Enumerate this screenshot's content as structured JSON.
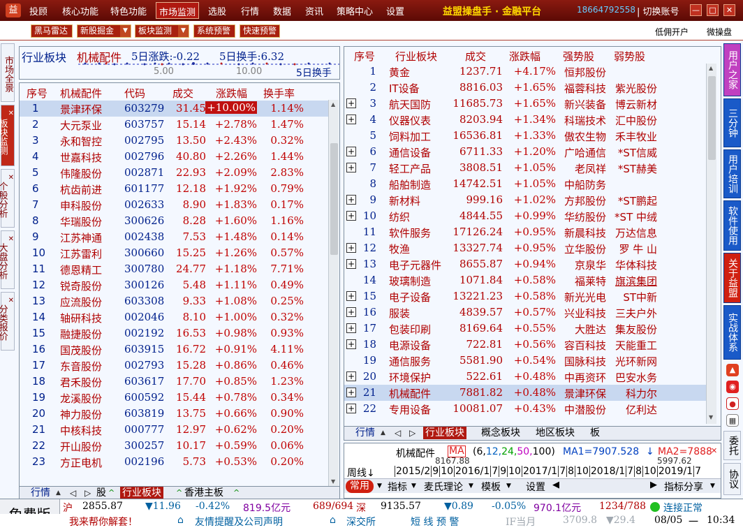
{
  "menu": {
    "items": [
      "投顾",
      "核心功能",
      "特色功能",
      "市场监测",
      "选股",
      "行情",
      "数据",
      "资讯",
      "策略中心",
      "设置"
    ],
    "brand": "益盟操盘手 · 金融平台",
    "phone": "18664792558",
    "switch_account": "| 切换账号"
  },
  "toolbar": {
    "buttons": [
      "黑马雷达",
      "新股掘金",
      "板块监测",
      "系统预警",
      "快速预警"
    ],
    "right1": "低佣开户",
    "right2": "微操盘"
  },
  "left_tabs": [
    "市场全景",
    "板块监测",
    "个股分析",
    "大盘分析",
    "分类报价"
  ],
  "sector_header": {
    "title": "行业板块",
    "name": "机械配件",
    "chg5": "5日涨跌:-0.22",
    "turn5": "5日换手:6.32",
    "tick1": "5.00",
    "tick2": "10.00",
    "tick3": "5日换手"
  },
  "stock_table": {
    "headers": [
      "序号",
      "机械配件",
      "代码",
      "成交",
      "涨跌幅",
      "换手率"
    ],
    "rows": [
      [
        "1",
        "景津环保",
        "603279",
        "31.45",
        "+10.00%",
        "1.14%"
      ],
      [
        "2",
        "大元泵业",
        "603757",
        "15.14",
        "+2.78%",
        "1.47%"
      ],
      [
        "3",
        "永和智控",
        "002795",
        "13.50",
        "+2.43%",
        "0.32%"
      ],
      [
        "4",
        "世嘉科技",
        "002796",
        "40.80",
        "+2.26%",
        "1.44%"
      ],
      [
        "5",
        "伟隆股份",
        "002871",
        "22.93",
        "+2.09%",
        "2.83%"
      ],
      [
        "6",
        "杭齿前进",
        "601177",
        "12.18",
        "+1.92%",
        "0.79%"
      ],
      [
        "7",
        "申科股份",
        "002633",
        "8.90",
        "+1.83%",
        "0.17%"
      ],
      [
        "8",
        "华瑞股份",
        "300626",
        "8.28",
        "+1.60%",
        "1.16%"
      ],
      [
        "9",
        "江苏神通",
        "002438",
        "7.53",
        "+1.48%",
        "0.14%"
      ],
      [
        "10",
        "江苏雷利",
        "300660",
        "15.25",
        "+1.26%",
        "0.57%"
      ],
      [
        "11",
        "德恩精工",
        "300780",
        "24.77",
        "+1.18%",
        "7.71%"
      ],
      [
        "12",
        "锐奇股份",
        "300126",
        "5.48",
        "+1.11%",
        "0.49%"
      ],
      [
        "13",
        "应流股份",
        "603308",
        "9.33",
        "+1.08%",
        "0.25%"
      ],
      [
        "14",
        "轴研科技",
        "002046",
        "8.10",
        "+1.00%",
        "0.32%"
      ],
      [
        "15",
        "融捷股份",
        "002192",
        "16.53",
        "+0.98%",
        "0.93%"
      ],
      [
        "16",
        "国茂股份",
        "603915",
        "16.72",
        "+0.91%",
        "4.11%"
      ],
      [
        "17",
        "东音股份",
        "002793",
        "15.28",
        "+0.86%",
        "0.46%"
      ],
      [
        "18",
        "君禾股份",
        "603617",
        "17.70",
        "+0.85%",
        "1.23%"
      ],
      [
        "19",
        "龙溪股份",
        "600592",
        "15.44",
        "+0.78%",
        "0.34%"
      ],
      [
        "20",
        "神力股份",
        "603819",
        "13.75",
        "+0.66%",
        "0.90%"
      ],
      [
        "21",
        "中核科技",
        "000777",
        "12.97",
        "+0.62%",
        "0.20%"
      ],
      [
        "22",
        "开山股份",
        "300257",
        "10.17",
        "+0.59%",
        "0.06%"
      ],
      [
        "23",
        "方正电机",
        "002196",
        "5.73",
        "+0.53%",
        "0.20%"
      ]
    ]
  },
  "left_bottom_tabs": [
    "行情",
    "股",
    "行业板块",
    "香港主板"
  ],
  "sector_table": {
    "headers": [
      "序号",
      "行业板块",
      "成交",
      "涨跌幅",
      "强势股",
      "弱势股"
    ],
    "rows": [
      [
        "1",
        "黄金",
        "1237.71",
        "+4.17%",
        "恒邦股份",
        ""
      ],
      [
        "2",
        "IT设备",
        "8816.03",
        "+1.65%",
        "福蓉科技",
        "紫光股份"
      ],
      [
        "3",
        "航天国防",
        "11685.73",
        "+1.65%",
        "新兴装备",
        "博云新材"
      ],
      [
        "4",
        "仪器仪表",
        "8203.94",
        "+1.34%",
        "科瑞技术",
        "汇中股份"
      ],
      [
        "5",
        "饲料加工",
        "16536.81",
        "+1.33%",
        "傲农生物",
        "禾丰牧业"
      ],
      [
        "6",
        "通信设备",
        "6711.33",
        "+1.20%",
        "广哈通信",
        "*ST信威"
      ],
      [
        "7",
        "轻工产品",
        "3808.51",
        "+1.05%",
        "老凤祥",
        "*ST赫美"
      ],
      [
        "8",
        "船舶制造",
        "14742.51",
        "+1.05%",
        "中船防务",
        ""
      ],
      [
        "9",
        "新材料",
        "999.16",
        "+1.02%",
        "方邦股份",
        "*ST鹏起"
      ],
      [
        "10",
        "纺织",
        "4844.55",
        "+0.99%",
        "华纺股份",
        "*ST 中绒"
      ],
      [
        "11",
        "软件服务",
        "17126.24",
        "+0.95%",
        "新晨科技",
        "万达信息"
      ],
      [
        "12",
        "牧渔",
        "13327.74",
        "+0.95%",
        "立华股份",
        "罗 牛 山"
      ],
      [
        "13",
        "电子元器件",
        "8655.87",
        "+0.94%",
        "京泉华",
        "华体科技"
      ],
      [
        "14",
        "玻璃制造",
        "1071.84",
        "+0.58%",
        "福莱特",
        "旗滨集团"
      ],
      [
        "15",
        "电子设备",
        "13221.23",
        "+0.58%",
        "新光光电",
        "ST中新"
      ],
      [
        "16",
        "服装",
        "4839.57",
        "+0.57%",
        "兴业科技",
        "三夫户外"
      ],
      [
        "17",
        "包装印刷",
        "8169.64",
        "+0.55%",
        "大胜达",
        "集友股份"
      ],
      [
        "18",
        "电源设备",
        "722.81",
        "+0.56%",
        "容百科技",
        "天能重工"
      ],
      [
        "19",
        "通信服务",
        "5581.90",
        "+0.54%",
        "国脉科技",
        "光环新网"
      ],
      [
        "20",
        "环境保护",
        "522.61",
        "+0.48%",
        "中再资环",
        "巴安水务"
      ],
      [
        "21",
        "机械配件",
        "7881.82",
        "+0.48%",
        "景津环保",
        "科力尔"
      ],
      [
        "22",
        "专用设备",
        "10081.07",
        "+0.43%",
        "中潜股份",
        "亿利达"
      ]
    ]
  },
  "right_bottom_tabs": [
    "行情",
    "行业板块",
    "概念板块",
    "地区板块",
    "板"
  ],
  "chart": {
    "name": "机械配件",
    "ma_label": "MA",
    "ma_params": [
      "(6,",
      "12,",
      "24,",
      "50,",
      "100)"
    ],
    "ma1": "MA1=7907.528",
    "ma2": "MA2=7888",
    "price1": "8167.88",
    "price2": "5997.62",
    "period": "周线",
    "dates": [
      "2015/2",
      "9",
      "10",
      "2016/1",
      "7",
      "9",
      "10",
      "2017/1",
      "7",
      "8",
      "10",
      "2018/1",
      "7",
      "8",
      "10",
      "2019/1",
      "7"
    ]
  },
  "chart_toolbar": [
    "常用",
    "指标",
    "麦氏理论",
    "模板",
    "设置",
    "指标分享"
  ],
  "right_tabs": [
    "用户之家",
    "三分钟",
    "用户培训",
    "软件使用",
    "关于益盟",
    "实战体系",
    "委托",
    "协议"
  ],
  "status": {
    "sh_label": "沪",
    "sh_index": "2855.87",
    "sh_chg": "▼11.96",
    "sh_pct": "-0.42%",
    "sh_amt": "819.5亿元",
    "sh_ud": "689/694",
    "sz_label": "深",
    "sz_index": "9135.57",
    "sz_chg": "▼0.89",
    "sz_pct": "-0.05%",
    "sz_amt": "970.1亿元",
    "sz_ud": "1234/788",
    "conn": "连接正常",
    "edition": "免费版",
    "msg1": "我来帮你解套！",
    "msg2": "友情提醒及公司声明",
    "msg3": "深交所",
    "alert": "短 线 预 警",
    "if_label": "IF当月",
    "if_val": "3709.8",
    "if_chg": "▼29.4",
    "date": "08/05",
    "weekday": "一",
    "time": "10:34"
  },
  "colors": {
    "menu_bg": "#6a1008",
    "accent_red": "#b00000",
    "up_red": "#c00000",
    "text_blue": "#00208c",
    "highlight_row": "#c8d8f0",
    "sidebar_blue": "#1a5ac8"
  }
}
